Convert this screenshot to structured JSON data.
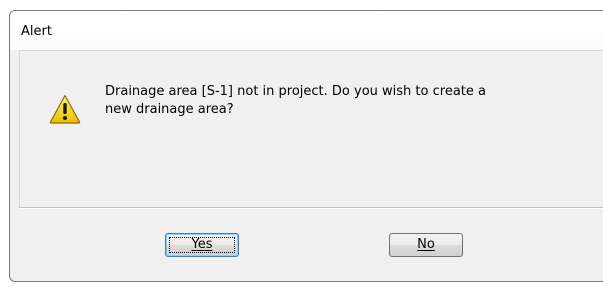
{
  "dialog": {
    "title": "Alert",
    "icon": "warning-icon",
    "message_line1": "Drainage area [S-1] not in project. Do you wish to create a",
    "message_line2": "new drainage area?",
    "buttons": {
      "yes_label": "Yes",
      "no_label": "No"
    }
  },
  "colors": {
    "warning_fill": "#f7d21a",
    "dialog_bg": "#f0f0f0",
    "default_button_border": "#3c7fb1"
  }
}
